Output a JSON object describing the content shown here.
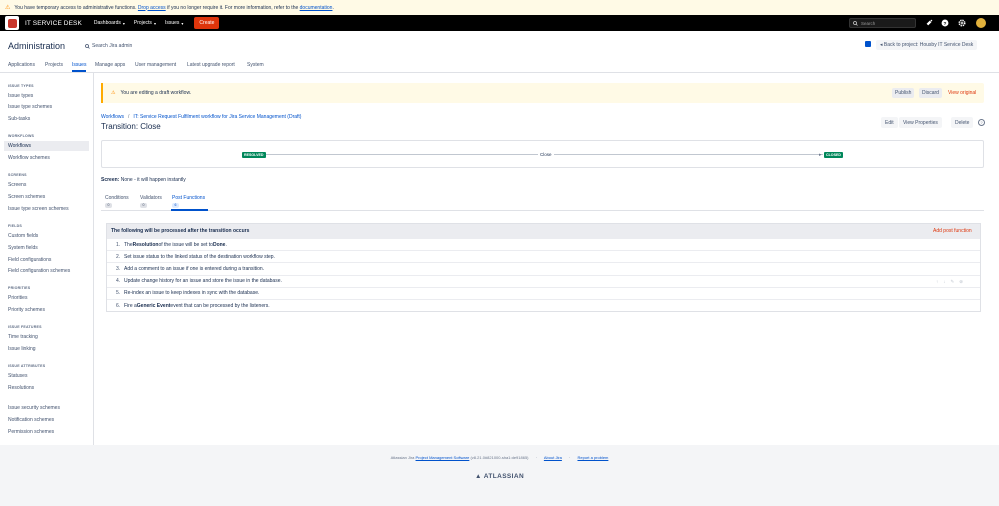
{
  "banner": {
    "prefix": "You have temporary access to administrative functions.",
    "drop_link": "Drop access",
    "middle": "if you no longer require it. For more information, refer to the",
    "doc_link": "documentation",
    "suffix": "."
  },
  "topnav": {
    "brand": "IT SERVICE DESK",
    "items": [
      "Dashboards",
      "Projects",
      "Issues"
    ],
    "create": "Create",
    "search_placeholder": "Search"
  },
  "admin": {
    "title": "Administration",
    "search_label": "Search Jira admin",
    "back_button": "Back to project: Housby IT Service Desk",
    "tabs": [
      "Applications",
      "Projects",
      "Issues",
      "Manage apps",
      "User management",
      "Latest upgrade report",
      "System"
    ],
    "active_tab": "Issues"
  },
  "sidebar": {
    "sections": [
      {
        "title": "ISSUE TYPES",
        "items": [
          "Issue types",
          "Issue type schemes",
          "Sub-tasks"
        ]
      },
      {
        "title": "WORKFLOWS",
        "items": [
          "Workflows",
          "Workflow schemes"
        ]
      },
      {
        "title": "SCREENS",
        "items": [
          "Screens",
          "Screen schemes",
          "Issue type screen schemes"
        ]
      },
      {
        "title": "FIELDS",
        "items": [
          "Custom fields",
          "System fields",
          "Field configurations",
          "Field configuration schemes"
        ]
      },
      {
        "title": "PRIORITIES",
        "items": [
          "Priorities",
          "Priority schemes"
        ]
      },
      {
        "title": "ISSUE FEATURES",
        "items": [
          "Time tracking",
          "Issue linking"
        ]
      },
      {
        "title": "ISSUE ATTRIBUTES",
        "items": [
          "Statuses",
          "Resolutions"
        ]
      },
      {
        "title": "",
        "items": [
          "Issue security schemes",
          "Notification schemes",
          "Permission schemes"
        ]
      }
    ],
    "active_item": "Workflows"
  },
  "draft": {
    "message": "You are editing a draft workflow.",
    "publish": "Publish",
    "discard": "Discard",
    "view_original": "View original"
  },
  "breadcrumb": {
    "root": "Workflows",
    "separator": "/",
    "workflow": "IT: Service Request Fulfilment workflow for Jira Service Management (Draft)"
  },
  "transition": {
    "title": "Transition: Close",
    "edit": "Edit",
    "view_properties": "View Properties",
    "delete": "Delete",
    "help": "?",
    "from_status": "RESOLVED",
    "name": "Close",
    "to_status": "CLOSED"
  },
  "screen": {
    "label": "Screen:",
    "value": "None - it will happen instantly"
  },
  "panel_tabs": [
    {
      "label": "Conditions",
      "count": "0"
    },
    {
      "label": "Validators",
      "count": "0"
    },
    {
      "label": "Post Functions",
      "count": "6"
    }
  ],
  "post_functions": {
    "header": "The following will be processed after the transition occurs",
    "add": "Add post function",
    "rows": [
      {
        "num": "1.",
        "pre": "The ",
        "bold": "Resolution",
        "mid": " of the issue will be set to ",
        "bold2": "Done",
        "post": "."
      },
      {
        "num": "2.",
        "pre": "Set issue status to the linked status of the destination workflow step.",
        "bold": "",
        "mid": "",
        "bold2": "",
        "post": ""
      },
      {
        "num": "3.",
        "pre": "Add a comment to an issue if one is entered during a transition.",
        "bold": "",
        "mid": "",
        "bold2": "",
        "post": ""
      },
      {
        "num": "4.",
        "pre": "Update change history for an issue and store the issue in the database.",
        "bold": "",
        "mid": "",
        "bold2": "",
        "post": ""
      },
      {
        "num": "5.",
        "pre": "Re-index an issue to keep indexes in sync with the database.",
        "bold": "",
        "mid": "",
        "bold2": "",
        "post": ""
      },
      {
        "num": "6.",
        "pre": "Fire a ",
        "bold": "Generic Event",
        "mid": " event that can be processed by the listeners.",
        "bold2": "",
        "post": ""
      }
    ]
  },
  "footer": {
    "prefix": "Atlassian Jira",
    "pms_link": "Project Management Software",
    "version": "(v8.21.0#821000-sha1:de91865)",
    "sep": "·",
    "about": "About Jira",
    "report": "Report a problem",
    "atlassian": "ATLASSIAN"
  },
  "colors": {
    "brand_red": "#c9372c",
    "create_button": "#de350b",
    "link": "#0052cc",
    "status_done": "#00875a",
    "warning_bg": "#fffae6"
  }
}
